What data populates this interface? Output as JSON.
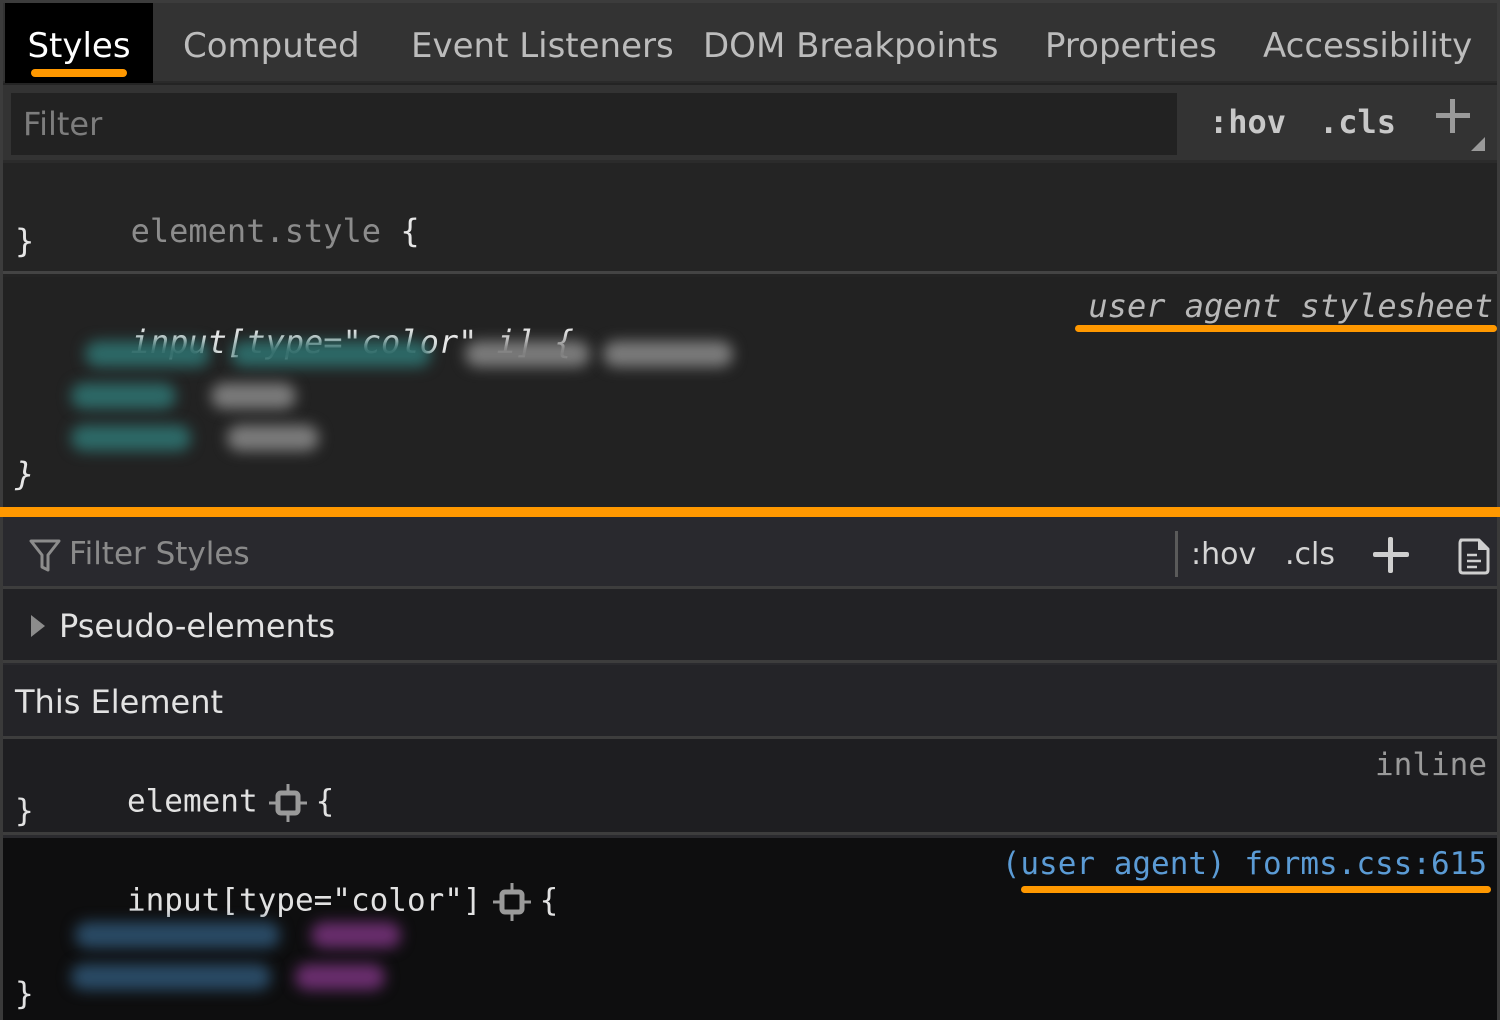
{
  "top_panel": {
    "tabs": [
      {
        "label": "Styles",
        "active": true
      },
      {
        "label": "Computed",
        "active": false
      },
      {
        "label": "Event Listeners",
        "active": false
      },
      {
        "label": "DOM Breakpoints",
        "active": false
      },
      {
        "label": "Properties",
        "active": false
      },
      {
        "label": "Accessibility",
        "active": false
      }
    ],
    "filter": {
      "placeholder": "Filter",
      "value": ""
    },
    "hov_label": ":hov",
    "cls_label": ".cls",
    "rules": [
      {
        "selector": "element.style",
        "open_brace": "{",
        "close_brace": "}"
      },
      {
        "selector": "input[type=\"color\" i]",
        "open_brace": "{",
        "close_brace": "}",
        "source": "user agent stylesheet",
        "declarations_blurred": true
      }
    ]
  },
  "bottom_panel": {
    "filter": {
      "placeholder": "Filter Styles",
      "value": ""
    },
    "hov_label": ":hov",
    "cls_label": ".cls",
    "pseudo_elements_label": "Pseudo-elements",
    "this_element_label": "This Element",
    "rules": [
      {
        "selector": "element",
        "open_brace": "{",
        "close_brace": "}",
        "source": "inline"
      },
      {
        "selector": "input[type=\"color\"]",
        "open_brace": "{",
        "close_brace": "}",
        "source": "(user agent) forms.css:615",
        "declarations_blurred": true
      }
    ]
  },
  "colors": {
    "highlight": "#ff9800",
    "link_blue": "#5b9bd5"
  }
}
